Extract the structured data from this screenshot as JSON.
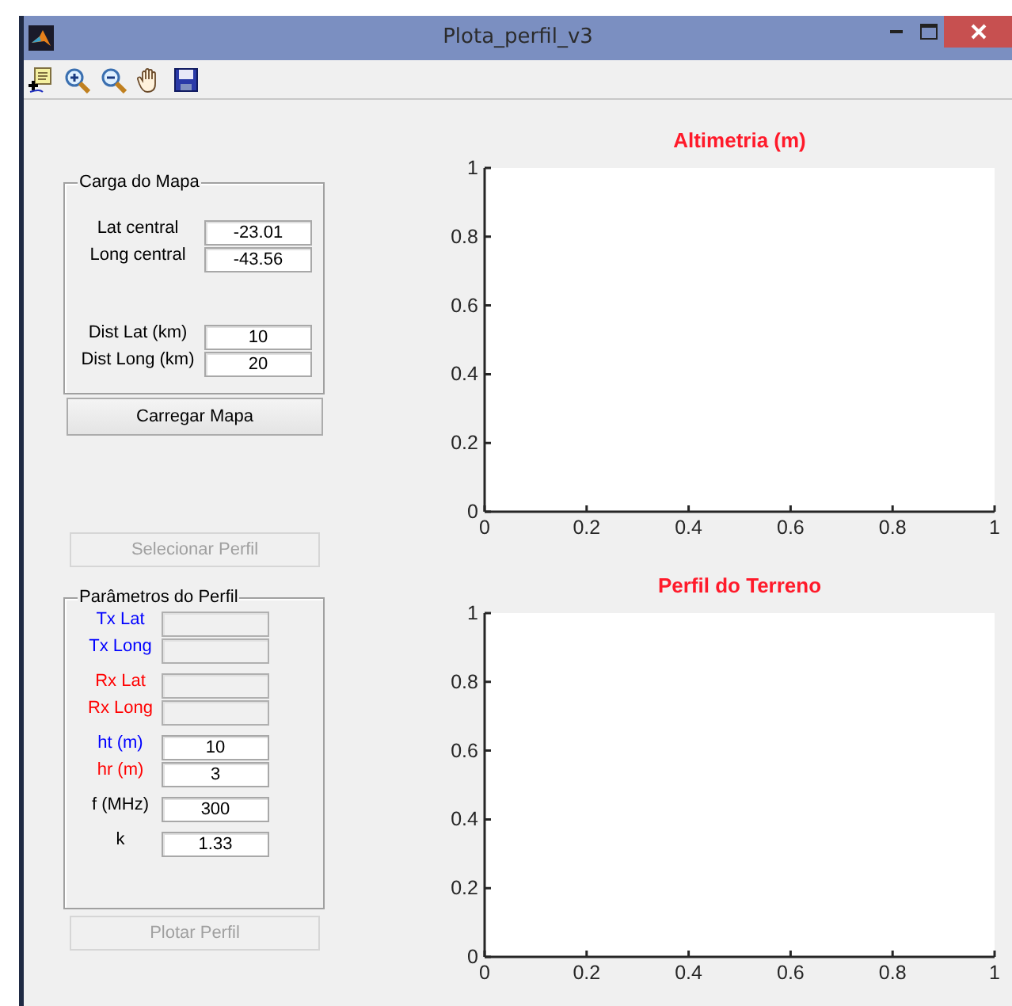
{
  "window": {
    "title": "Plota_perfil_v3"
  },
  "toolbar": [
    {
      "kind": "data-cursor"
    },
    {
      "kind": "zoom-in"
    },
    {
      "kind": "zoom-out"
    },
    {
      "kind": "pan"
    },
    {
      "kind": "save"
    }
  ],
  "map_panel": {
    "title": "Carga do Mapa",
    "groups": [
      [
        {
          "label": "Lat central",
          "value": "-23.01",
          "disabled": false
        },
        {
          "label": "Long central",
          "value": "-43.56",
          "disabled": false
        }
      ],
      [
        {
          "label": "Dist Lat (km)",
          "value": "10",
          "disabled": false
        },
        {
          "label": "Dist Long (km)",
          "value": "20",
          "disabled": false
        }
      ]
    ],
    "button": {
      "label": "Carregar Mapa",
      "disabled": false
    }
  },
  "select_button": {
    "label": "Selecionar Perfil",
    "disabled": true
  },
  "profile_panel": {
    "title": "Parâmetros do Perfil",
    "groups": [
      [
        {
          "label": "Tx Lat",
          "disabled": true,
          "color": "#0000ff"
        },
        {
          "label": "Tx Long",
          "disabled": true,
          "color": "#0000ff"
        }
      ],
      [
        {
          "label": "Rx Lat",
          "disabled": true,
          "color": "#ff0000"
        },
        {
          "label": "Rx Long",
          "disabled": true,
          "color": "#ff0000"
        }
      ],
      [
        {
          "label": "ht (m)",
          "value": "10",
          "disabled": false,
          "color": "#0000ff"
        },
        {
          "label": "hr (m)",
          "value": "3",
          "disabled": false,
          "color": "#ff0000"
        }
      ],
      [
        {
          "label": "f (MHz)",
          "value": "300",
          "disabled": false,
          "color": "#000000"
        }
      ],
      [
        {
          "label": "k",
          "value": "1.33",
          "disabled": false,
          "color": "#000000"
        }
      ]
    ]
  },
  "plot_button": {
    "label": "Plotar Perfil",
    "disabled": true
  },
  "charts": [
    {
      "chart_data": {
        "type": "line",
        "title": "Altimetria (m)",
        "xlim": [
          0,
          1
        ],
        "ylim": [
          0,
          1
        ],
        "xticks": [
          0,
          0.2,
          0.4,
          0.6,
          0.8,
          1
        ],
        "yticks": [
          0,
          0.2,
          0.4,
          0.6,
          0.8,
          1
        ]
      }
    },
    {
      "chart_data": {
        "type": "line",
        "title": "Perfil do Terreno",
        "xlim": [
          0,
          1
        ],
        "ylim": [
          0,
          1
        ],
        "xticks": [
          0,
          0.2,
          0.4,
          0.6,
          0.8,
          1
        ],
        "yticks": [
          0,
          0.2,
          0.4,
          0.6,
          0.8,
          1
        ]
      }
    }
  ]
}
